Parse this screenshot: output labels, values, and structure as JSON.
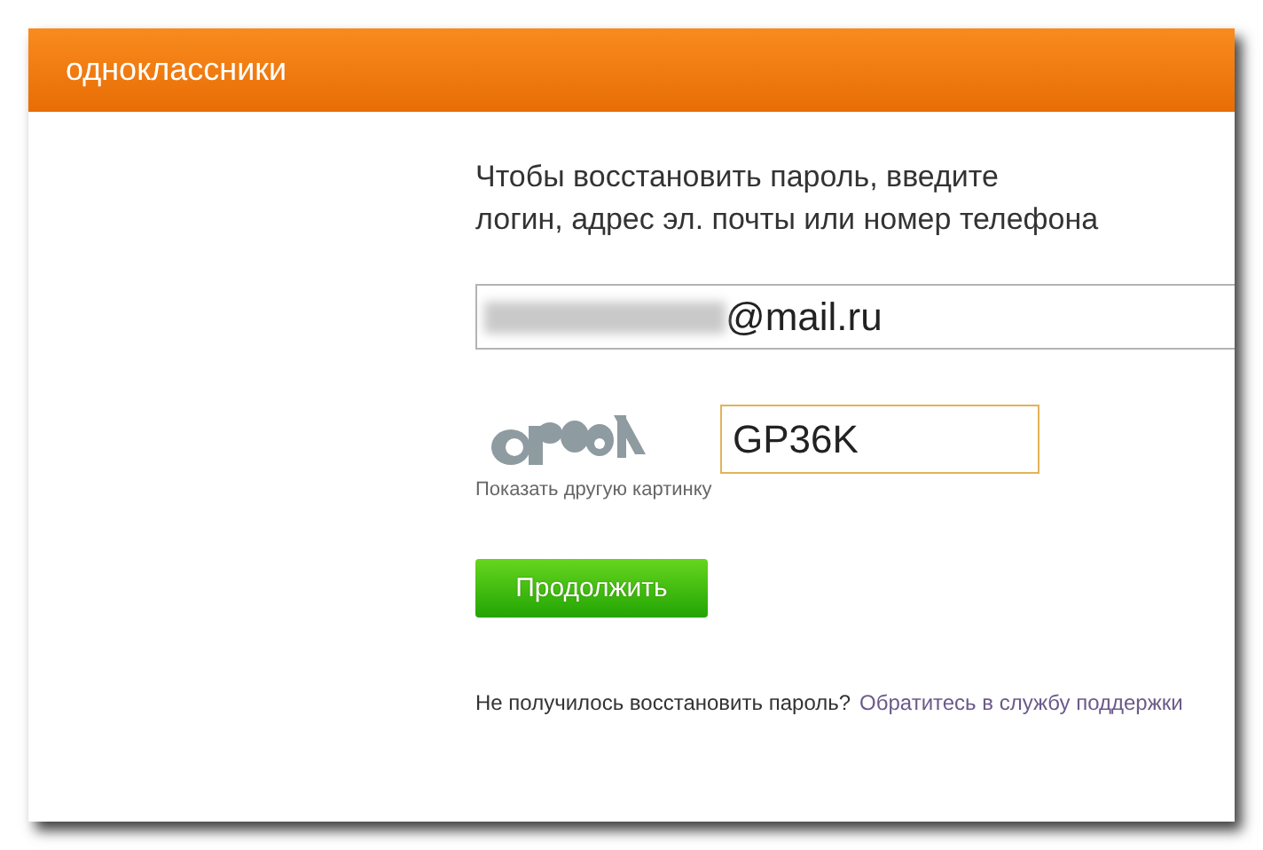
{
  "header": {
    "title": "одноклассники"
  },
  "form": {
    "instructions": "Чтобы восстановить пароль, введите\nлогин, адрес эл. почты или номер телефона",
    "login_field": {
      "value": "@mail.ru",
      "blurred_prefix": true
    },
    "captcha": {
      "value": "GP36K",
      "focused": true,
      "refresh_link": "Показать другую картинку"
    },
    "submit_button": "Продолжить",
    "help": {
      "text": "Не получилось восстановить пароль?",
      "link": "Обратитесь в службу поддержки"
    }
  }
}
